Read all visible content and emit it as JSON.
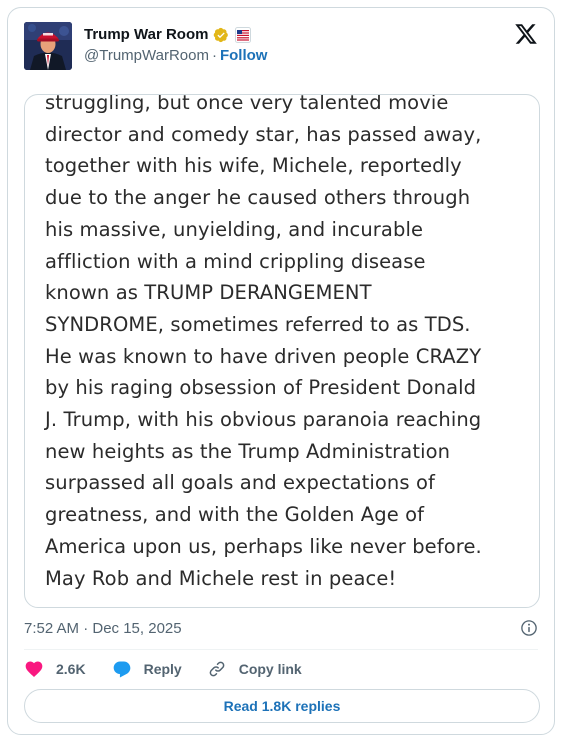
{
  "author": {
    "display_name": "Trump War Room",
    "handle": "@TrumpWarRoom",
    "follow_label": "Follow",
    "verified_badge_color": "#e2b719",
    "affiliate_icon": "affiliate-flag-icon"
  },
  "platform_logo": "x-logo-icon",
  "media_text_lines": [
    "struggling, but once very talented movie",
    "director and comedy star, has passed away,",
    "together with his wife, Michele, reportedly",
    "due to the anger he caused others through",
    "his massive, unyielding, and incurable",
    "affliction with a mind crippling disease",
    "known as TRUMP DERANGEMENT",
    "SYNDROME, sometimes referred to as TDS.",
    "He was known to have driven people CRAZY",
    "by his raging obsession of President Donald",
    "J. Trump, with his obvious paranoia reaching",
    "new heights as the Trump Administration",
    "surpassed all goals and expectations of",
    "greatness, and with the Golden Age of",
    "America upon us, perhaps like never before.",
    "May Rob and Michele rest in peace!"
  ],
  "timestamp": "7:52 AM · Dec 15, 2025",
  "actions": {
    "like_count": "2.6K",
    "reply_label": "Reply",
    "copy_link_label": "Copy link"
  },
  "read_replies_label": "Read 1.8K replies",
  "colors": {
    "like": "#f91880",
    "reply": "#1d9bf0",
    "link": "#1d72b8",
    "muted": "#536471"
  }
}
